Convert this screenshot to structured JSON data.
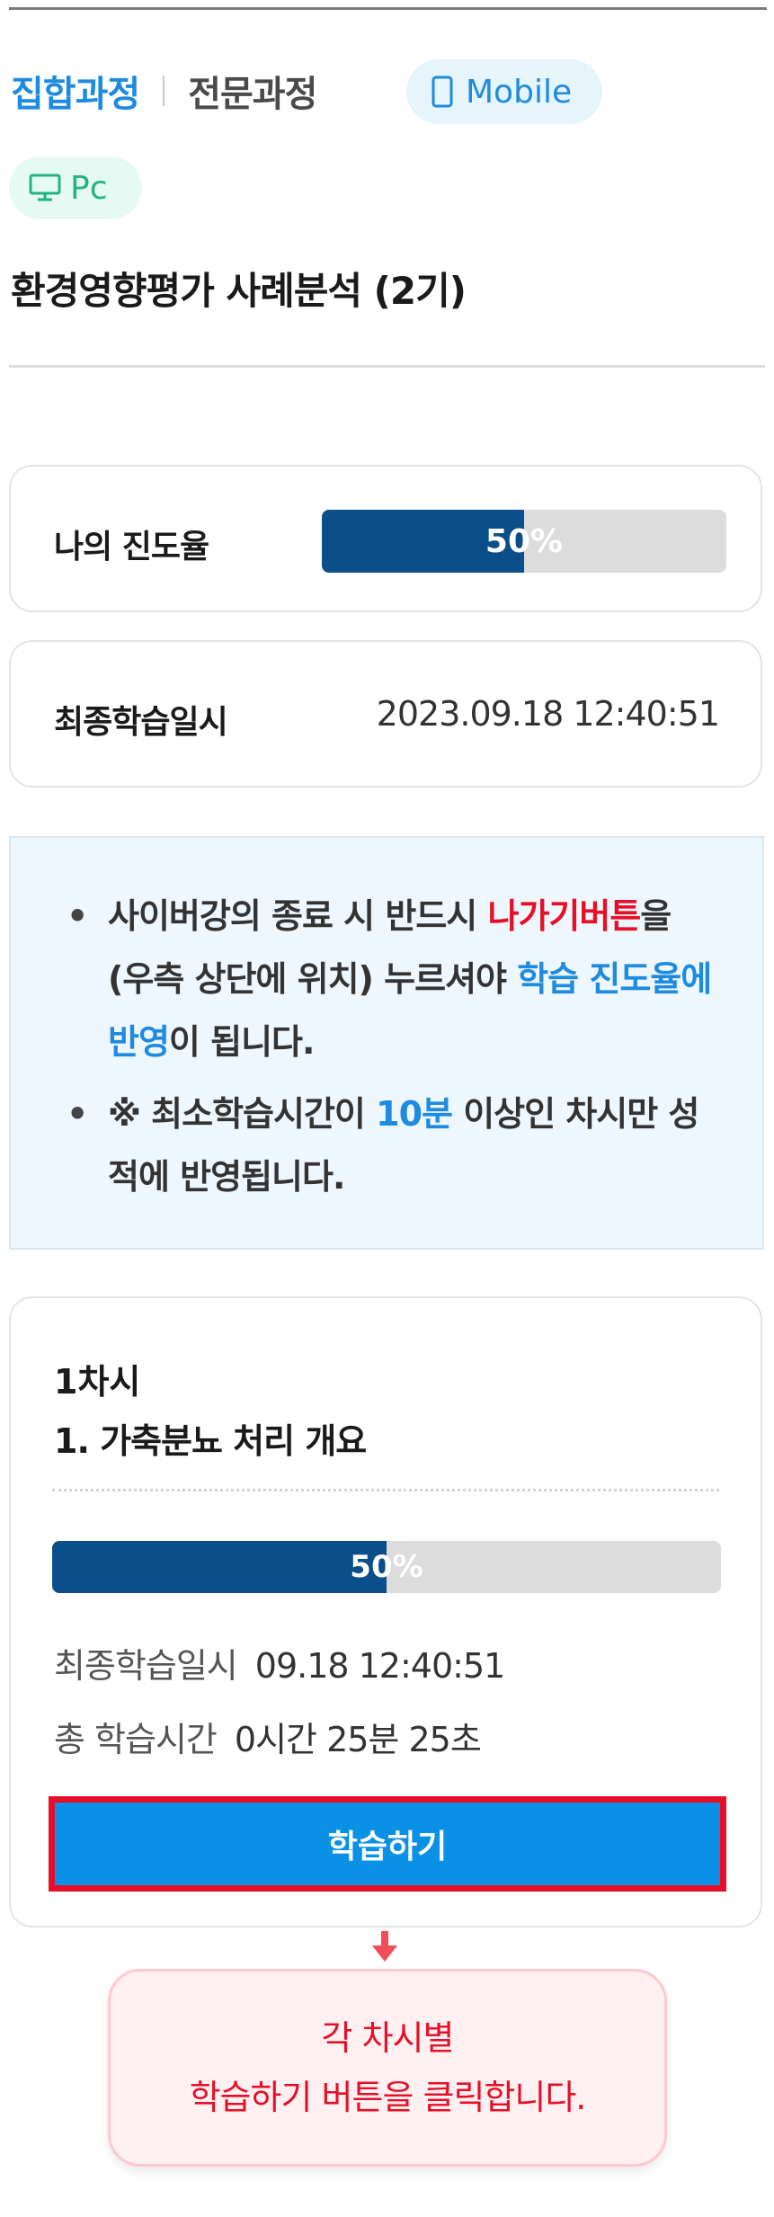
{
  "course_type_tabs": {
    "active": "집합과정",
    "other": "전문과정"
  },
  "platform_chips": {
    "mobile": "Mobile",
    "pc": "Pc"
  },
  "course_title": "환경영향평가 사례분석 (2기)",
  "my_progress": {
    "label": "나의 진도율",
    "value_text": "50%",
    "value": 0.5
  },
  "last_study": {
    "label": "최종학습일시",
    "value": "2023.09.18 12:40:51"
  },
  "notice": {
    "item1": {
      "part1": "사이버강의 종료 시 반드시 ",
      "highlight_red": "나가기버튼",
      "part2": "을 (우측 상단에 위치) 누르셔야 ",
      "highlight_blue": "학습 진도율에 반영",
      "part3": "이 됩니다."
    },
    "item2": {
      "part1": "※ 최소학습시간이 ",
      "highlight_blue": "10분",
      "part2": " 이상인 차시만 성적에 반영됩니다."
    }
  },
  "lesson": {
    "number": "1차시",
    "name": "1. 가축분뇨 처리 개요",
    "progress_text": "50%",
    "progress": 0.5,
    "last_study_label": "최종학습일시",
    "last_study_value": "09.18 12:40:51",
    "total_time_label": "총 학습시간",
    "total_time_value": "0시간 25분 25초",
    "study_button": "학습하기"
  },
  "callout": {
    "line1": "각 차시별",
    "line2": "학습하기 버튼을 클릭합니다."
  },
  "colors": {
    "accent_blue": "#1f8be0",
    "progress_fill": "#0b4f8a",
    "highlight_red": "#e60f27",
    "button_blue": "#0a91e6"
  },
  "icons": {
    "mobile": "mobile-phone-icon",
    "pc": "monitor-icon",
    "callout_arrow": "down-arrow-icon"
  }
}
